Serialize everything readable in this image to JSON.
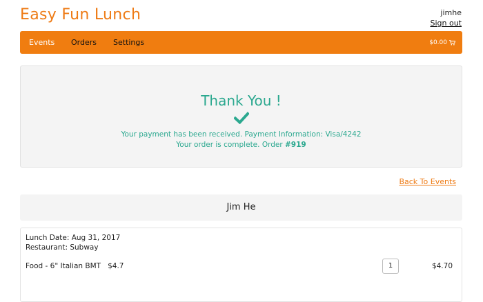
{
  "header": {
    "brand": "Easy Fun Lunch",
    "username": "jimhe",
    "signout_label": "Sign out"
  },
  "nav": {
    "items": [
      {
        "label": "Events"
      },
      {
        "label": "Orders"
      },
      {
        "label": "Settings"
      }
    ],
    "cart_total": "$0.00",
    "cart_icon": "shopping-cart-icon",
    "color": "#f07d10"
  },
  "confirmation": {
    "title": "Thank You !",
    "check_icon": "checkmark-icon",
    "payment_text": "Your payment has been received. Payment Information: Visa/4242",
    "order_text_prefix": "Your order is complete. Order ",
    "order_number": "#919",
    "color": "#2ba88f"
  },
  "back_link": "Back To Events",
  "customer_name": "Jim He",
  "order": {
    "lunch_date": "Lunch Date: Aug 31, 2017",
    "restaurant": "Restaurant: Subway",
    "item_label": "Food - 6\" Italian BMT",
    "item_price": "$4.7",
    "quantity": "1",
    "line_total": "$4.70"
  }
}
